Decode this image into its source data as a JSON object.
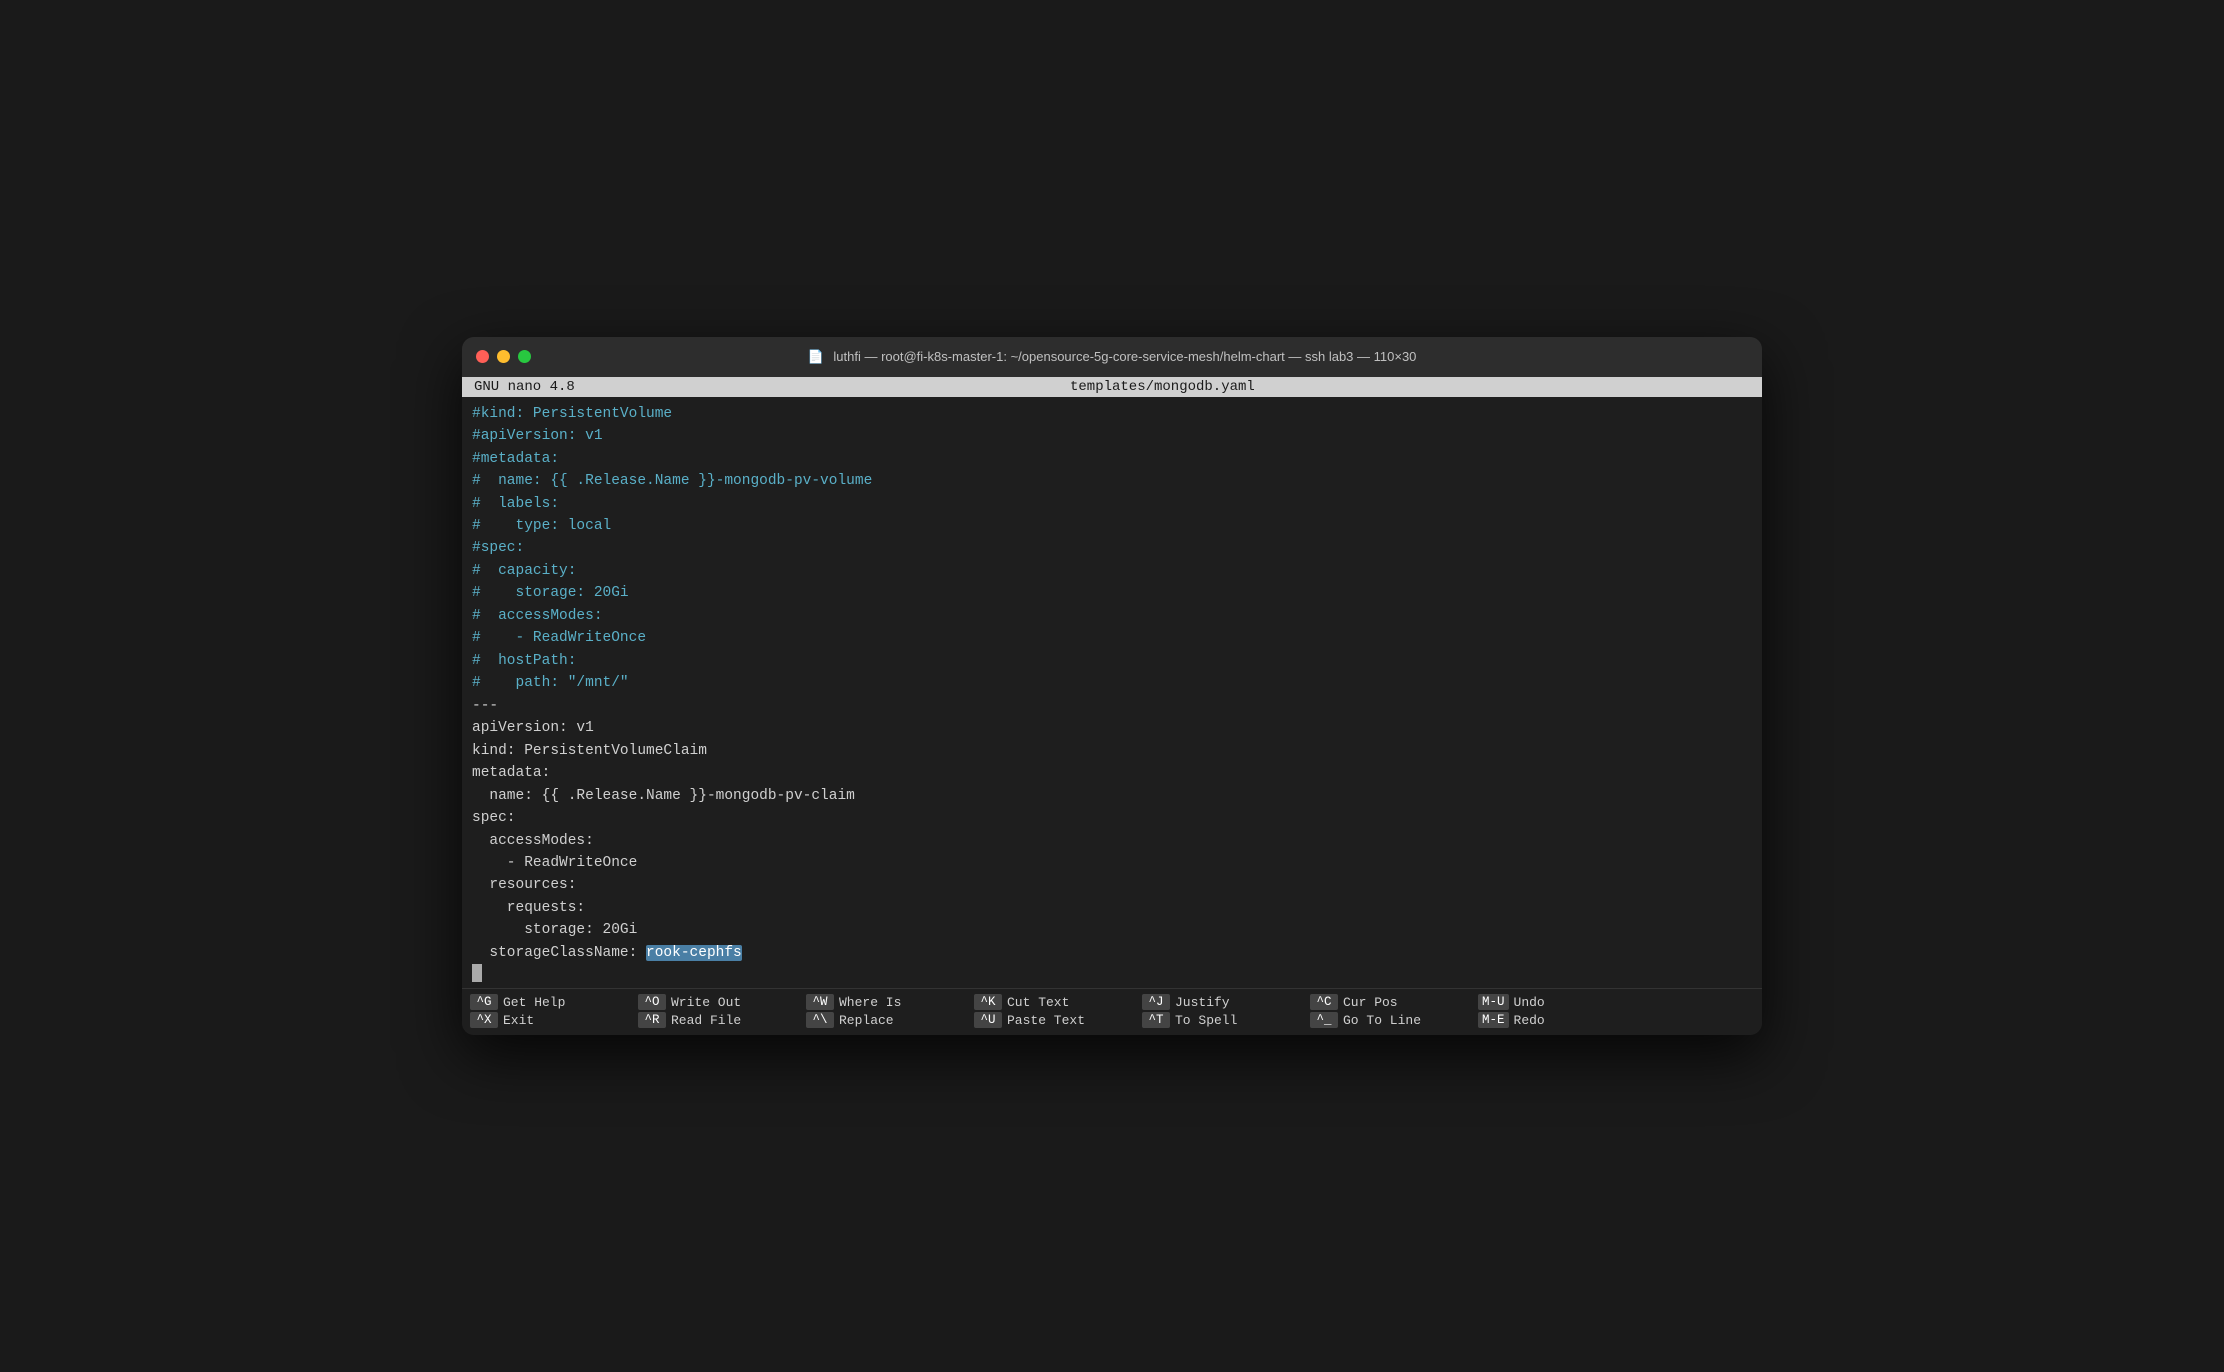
{
  "window": {
    "titlebar": {
      "title": "luthfi — root@fi-k8s-master-1: ~/opensource-5g-core-service-mesh/helm-chart — ssh lab3 — 110×30",
      "icon": "📄"
    },
    "nano_header": {
      "left": "GNU nano 4.8",
      "center": "templates/mongodb.yaml"
    }
  },
  "editor": {
    "lines": [
      {
        "type": "commented",
        "text": "#kind: PersistentVolume"
      },
      {
        "type": "commented",
        "text": "#apiVersion: v1"
      },
      {
        "type": "commented",
        "text": "#metadata:"
      },
      {
        "type": "commented",
        "text": "#  name: {{ .Release.Name }}-mongodb-pv-volume"
      },
      {
        "type": "commented",
        "text": "#  labels:"
      },
      {
        "type": "commented",
        "text": "#    type: local"
      },
      {
        "type": "commented",
        "text": "#spec:"
      },
      {
        "type": "commented",
        "text": "#  capacity:"
      },
      {
        "type": "commented",
        "text": "#    storage: 20Gi"
      },
      {
        "type": "commented",
        "text": "#  accessModes:"
      },
      {
        "type": "commented",
        "text": "#    - ReadWriteOnce"
      },
      {
        "type": "commented",
        "text": "#  hostPath:"
      },
      {
        "type": "commented",
        "text": "#    path: \"/mnt/\""
      },
      {
        "type": "normal",
        "text": "---"
      },
      {
        "type": "normal",
        "text": "apiVersion: v1"
      },
      {
        "type": "normal",
        "text": "kind: PersistentVolumeClaim"
      },
      {
        "type": "normal",
        "text": "metadata:"
      },
      {
        "type": "normal",
        "text": "  name: {{ .Release.Name }}-mongodb-pv-claim"
      },
      {
        "type": "normal",
        "text": "spec:"
      },
      {
        "type": "normal",
        "text": "  accessModes:"
      },
      {
        "type": "normal",
        "text": "    - ReadWriteOnce"
      },
      {
        "type": "normal",
        "text": "  resources:"
      },
      {
        "type": "normal",
        "text": "    requests:"
      },
      {
        "type": "normal",
        "text": "      storage: 20Gi"
      },
      {
        "type": "highlight_line",
        "before": "  storageClassName: ",
        "highlight": "rook-cephfs",
        "after": ""
      },
      {
        "type": "cursor",
        "text": ""
      }
    ]
  },
  "shortcuts": {
    "row1": [
      {
        "key": "^G",
        "label": "Get Help"
      },
      {
        "key": "^O",
        "label": "Write Out"
      },
      {
        "key": "^W",
        "label": "Where Is"
      },
      {
        "key": "^K",
        "label": "Cut Text"
      },
      {
        "key": "^J",
        "label": "Justify"
      },
      {
        "key": "^C",
        "label": "Cur Pos"
      },
      {
        "key": "M-U",
        "label": "Undo"
      }
    ],
    "row2": [
      {
        "key": "^X",
        "label": "Exit"
      },
      {
        "key": "^R",
        "label": "Read File"
      },
      {
        "key": "^\\",
        "label": "Replace"
      },
      {
        "key": "^U",
        "label": "Paste Text"
      },
      {
        "key": "^T",
        "label": "To Spell"
      },
      {
        "key": "^_",
        "label": "Go To Line"
      },
      {
        "key": "M-E",
        "label": "Redo"
      }
    ]
  }
}
